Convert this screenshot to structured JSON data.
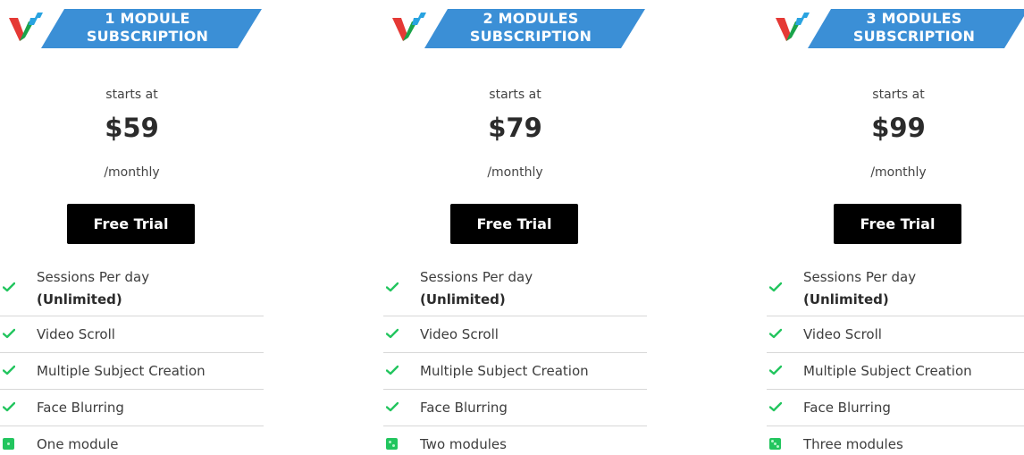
{
  "colors": {
    "ribbon": "#3b8fd6",
    "check": "#22c55e",
    "button": "#000000"
  },
  "plans": [
    {
      "ribbon": {
        "line1": "1 MODULE",
        "line2": "SUBSCRIPTION"
      },
      "starts_at": "starts at",
      "price": "$59",
      "period": "/monthly",
      "button": "Free Trial",
      "features": [
        {
          "text": "Sessions Per day",
          "strong": "(Unlimited)",
          "icon": "check-icon"
        },
        {
          "text": "Video Scroll",
          "icon": "check-icon"
        },
        {
          "text": "Multiple Subject Creation",
          "icon": "check-icon"
        },
        {
          "text": "Face Blurring",
          "icon": "check-icon"
        },
        {
          "text": "One module",
          "icon": "dice-icon"
        }
      ]
    },
    {
      "ribbon": {
        "line1": "2 MODULES",
        "line2": "SUBSCRIPTION"
      },
      "starts_at": "starts at",
      "price": "$79",
      "period": "/monthly",
      "button": "Free Trial",
      "features": [
        {
          "text": "Sessions Per day",
          "strong": "(Unlimited)",
          "icon": "check-icon"
        },
        {
          "text": "Video Scroll",
          "icon": "check-icon"
        },
        {
          "text": "Multiple Subject Creation",
          "icon": "check-icon"
        },
        {
          "text": "Face Blurring",
          "icon": "check-icon"
        },
        {
          "text": "Two modules",
          "icon": "dice-icon"
        }
      ]
    },
    {
      "ribbon": {
        "line1": "3 MODULES",
        "line2": "SUBSCRIPTION"
      },
      "starts_at": "starts at",
      "price": "$99",
      "period": "/monthly",
      "button": "Free Trial",
      "features": [
        {
          "text": "Sessions Per day",
          "strong": "(Unlimited)",
          "icon": "check-icon"
        },
        {
          "text": "Video Scroll",
          "icon": "check-icon"
        },
        {
          "text": "Multiple Subject Creation",
          "icon": "check-icon"
        },
        {
          "text": "Face Blurring",
          "icon": "check-icon"
        },
        {
          "text": "Three modules",
          "icon": "dice-icon"
        }
      ]
    }
  ]
}
